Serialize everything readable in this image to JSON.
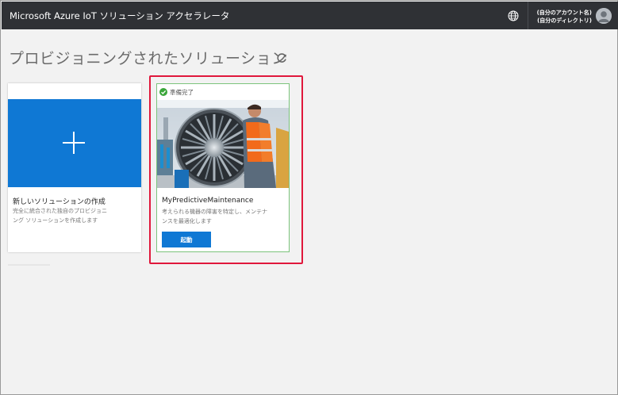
{
  "header": {
    "app_title": "Microsoft Azure IoT ソリューション アクセラレータ",
    "account_name": "(自分のアカウント名)",
    "directory_name": "(自分のディレクトリ)",
    "globe_icon": "globe-icon",
    "avatar_icon": "user-avatar-icon"
  },
  "page": {
    "title": "プロビジョニングされたソリューション",
    "refresh_icon": "refresh-icon"
  },
  "cards": {
    "new_solution": {
      "title": "新しいソリューションの作成",
      "description_line1": "完全に統合された独自のプロビジョニ",
      "description_line2": "ング ソリューションを作成します",
      "icon": "plus-icon",
      "accent_color": "#0f78d4"
    },
    "provisioned": {
      "status": "準備完了",
      "status_color": "#3aa63a",
      "title": "MyPredictiveMaintenance",
      "description_line1": "考えられる機器の障害を特定し、メンテナ",
      "description_line2": "ンスを最適化します",
      "launch_label": "起動",
      "image": "jet-engine-photo"
    }
  },
  "colors": {
    "header_bg": "#2f3135",
    "page_bg": "#f2f2f2",
    "highlight": "#e0183c",
    "button": "#0f78d4"
  }
}
